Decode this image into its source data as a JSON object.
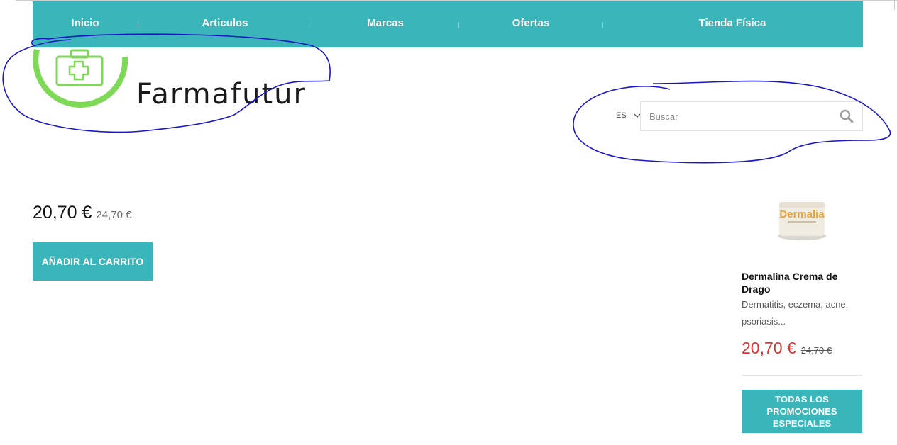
{
  "nav": {
    "items": [
      {
        "label": "Inicio"
      },
      {
        "label": "Articulos"
      },
      {
        "label": "Marcas"
      },
      {
        "label": "Ofertas"
      },
      {
        "label": "Tienda Física"
      }
    ]
  },
  "logo": {
    "text": "Farmafutur",
    "icon": "medical-kit-icon",
    "ring_color": "#7ed957"
  },
  "search": {
    "language": "ES",
    "placeholder": "Buscar",
    "icon": "search-icon"
  },
  "product": {
    "price": "20,70 €",
    "old_price": "24,70 €",
    "add_to_cart_label": "AÑADIR AL CARRITO"
  },
  "sidebar": {
    "product_image_label": "Dermalia",
    "title": "Dermalina Crema de Drago",
    "description": "Dermatitis, eczema, acne, psoriasis...",
    "price": "20,70 €",
    "old_price": "24,70 €",
    "promo_label": "TODAS LOS PROMOCIONES ESPECIALES"
  },
  "colors": {
    "accent": "#3ab5b9",
    "sale_price": "#e0302e",
    "annotation_stroke": "#1a16c8",
    "logo_green": "#7ed957"
  }
}
